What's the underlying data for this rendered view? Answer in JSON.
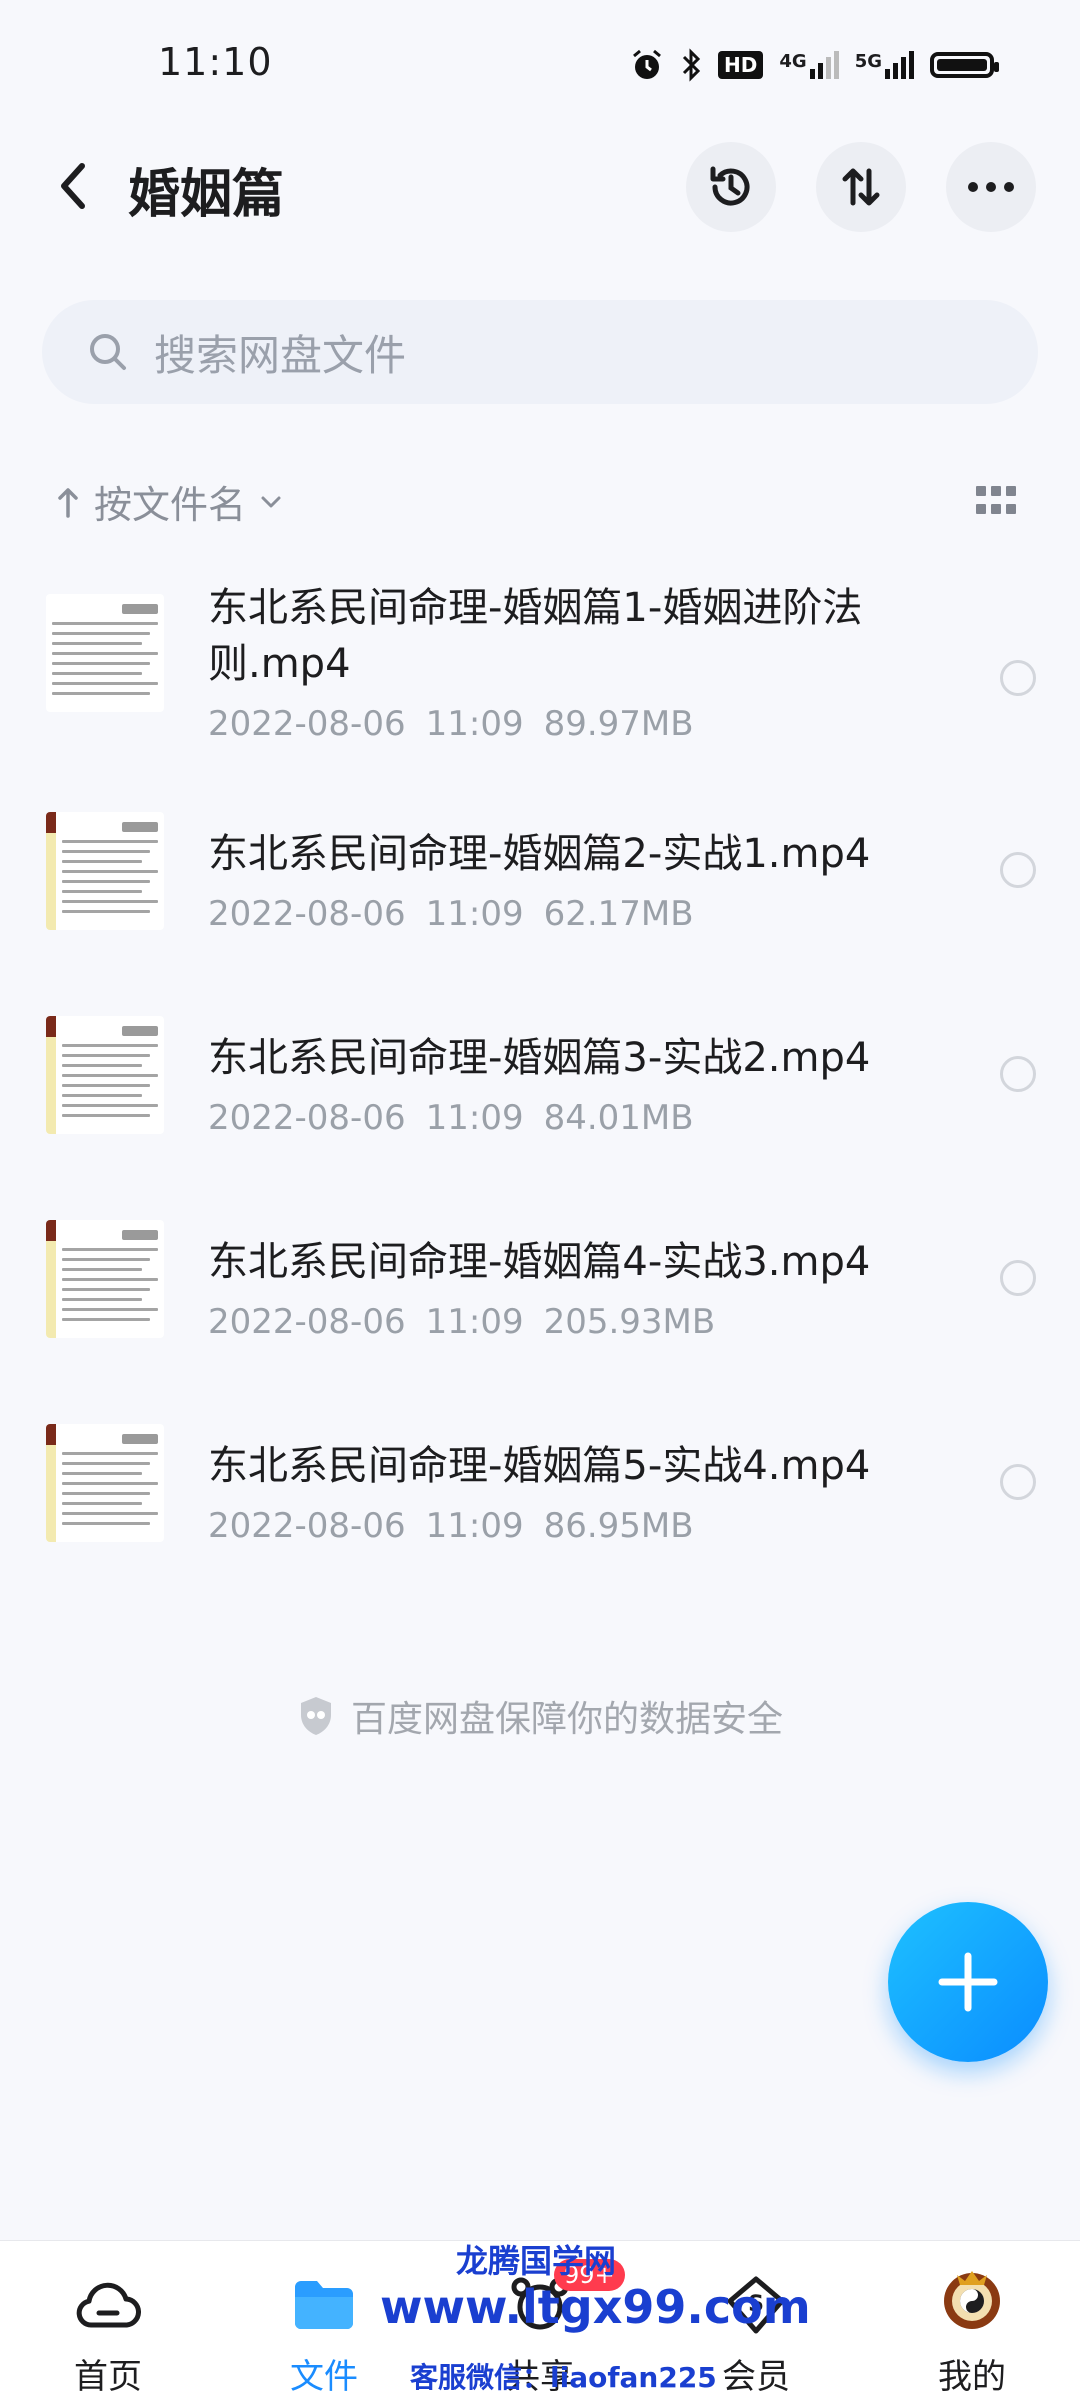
{
  "status_bar": {
    "time": "11:10",
    "icons": [
      "alarm-icon",
      "bluetooth-icon",
      "hd-icon",
      "4g-signal-icon",
      "5g-signal-icon",
      "battery-icon"
    ],
    "hd_label": "HD",
    "net4g": "4G",
    "net5g": "5G"
  },
  "header": {
    "title": "婚姻篇",
    "actions": [
      "history-icon",
      "sort-icon",
      "more-icon"
    ]
  },
  "search": {
    "placeholder": "搜索网盘文件"
  },
  "sort": {
    "label": "按文件名"
  },
  "files": [
    {
      "name": "东北系民间命理-婚姻篇1-婚姻进阶法则.mp4",
      "date": "2022-08-06",
      "time": "11:09",
      "size": "89.97MB"
    },
    {
      "name": "东北系民间命理-婚姻篇2-实战1.mp4",
      "date": "2022-08-06",
      "time": "11:09",
      "size": "62.17MB"
    },
    {
      "name": "东北系民间命理-婚姻篇3-实战2.mp4",
      "date": "2022-08-06",
      "time": "11:09",
      "size": "84.01MB"
    },
    {
      "name": "东北系民间命理-婚姻篇4-实战3.mp4",
      "date": "2022-08-06",
      "time": "11:09",
      "size": "205.93MB"
    },
    {
      "name": "东北系民间命理-婚姻篇5-实战4.mp4",
      "date": "2022-08-06",
      "time": "11:09",
      "size": "86.95MB"
    }
  ],
  "footer_note": "百度网盘保障你的数据安全",
  "bottom_nav": {
    "items": [
      {
        "label": "首页",
        "icon": "home-cloud-icon",
        "active": false
      },
      {
        "label": "文件",
        "icon": "folder-icon",
        "active": true
      },
      {
        "label": "共享",
        "icon": "share-icon",
        "active": false,
        "badge": "99+"
      },
      {
        "label": "会员",
        "icon": "vip-icon",
        "active": false
      },
      {
        "label": "我的",
        "icon": "avatar-icon",
        "active": false
      }
    ]
  },
  "watermark": {
    "line1": "龙腾国学网",
    "line2": "www.ltgx99.com",
    "line3": "客服微信：liaofan225"
  },
  "colors": {
    "accent": "#1a8cff",
    "fab": "#0a8cff",
    "badge": "#ff3b4e",
    "watermark": "#1a3fd0"
  }
}
